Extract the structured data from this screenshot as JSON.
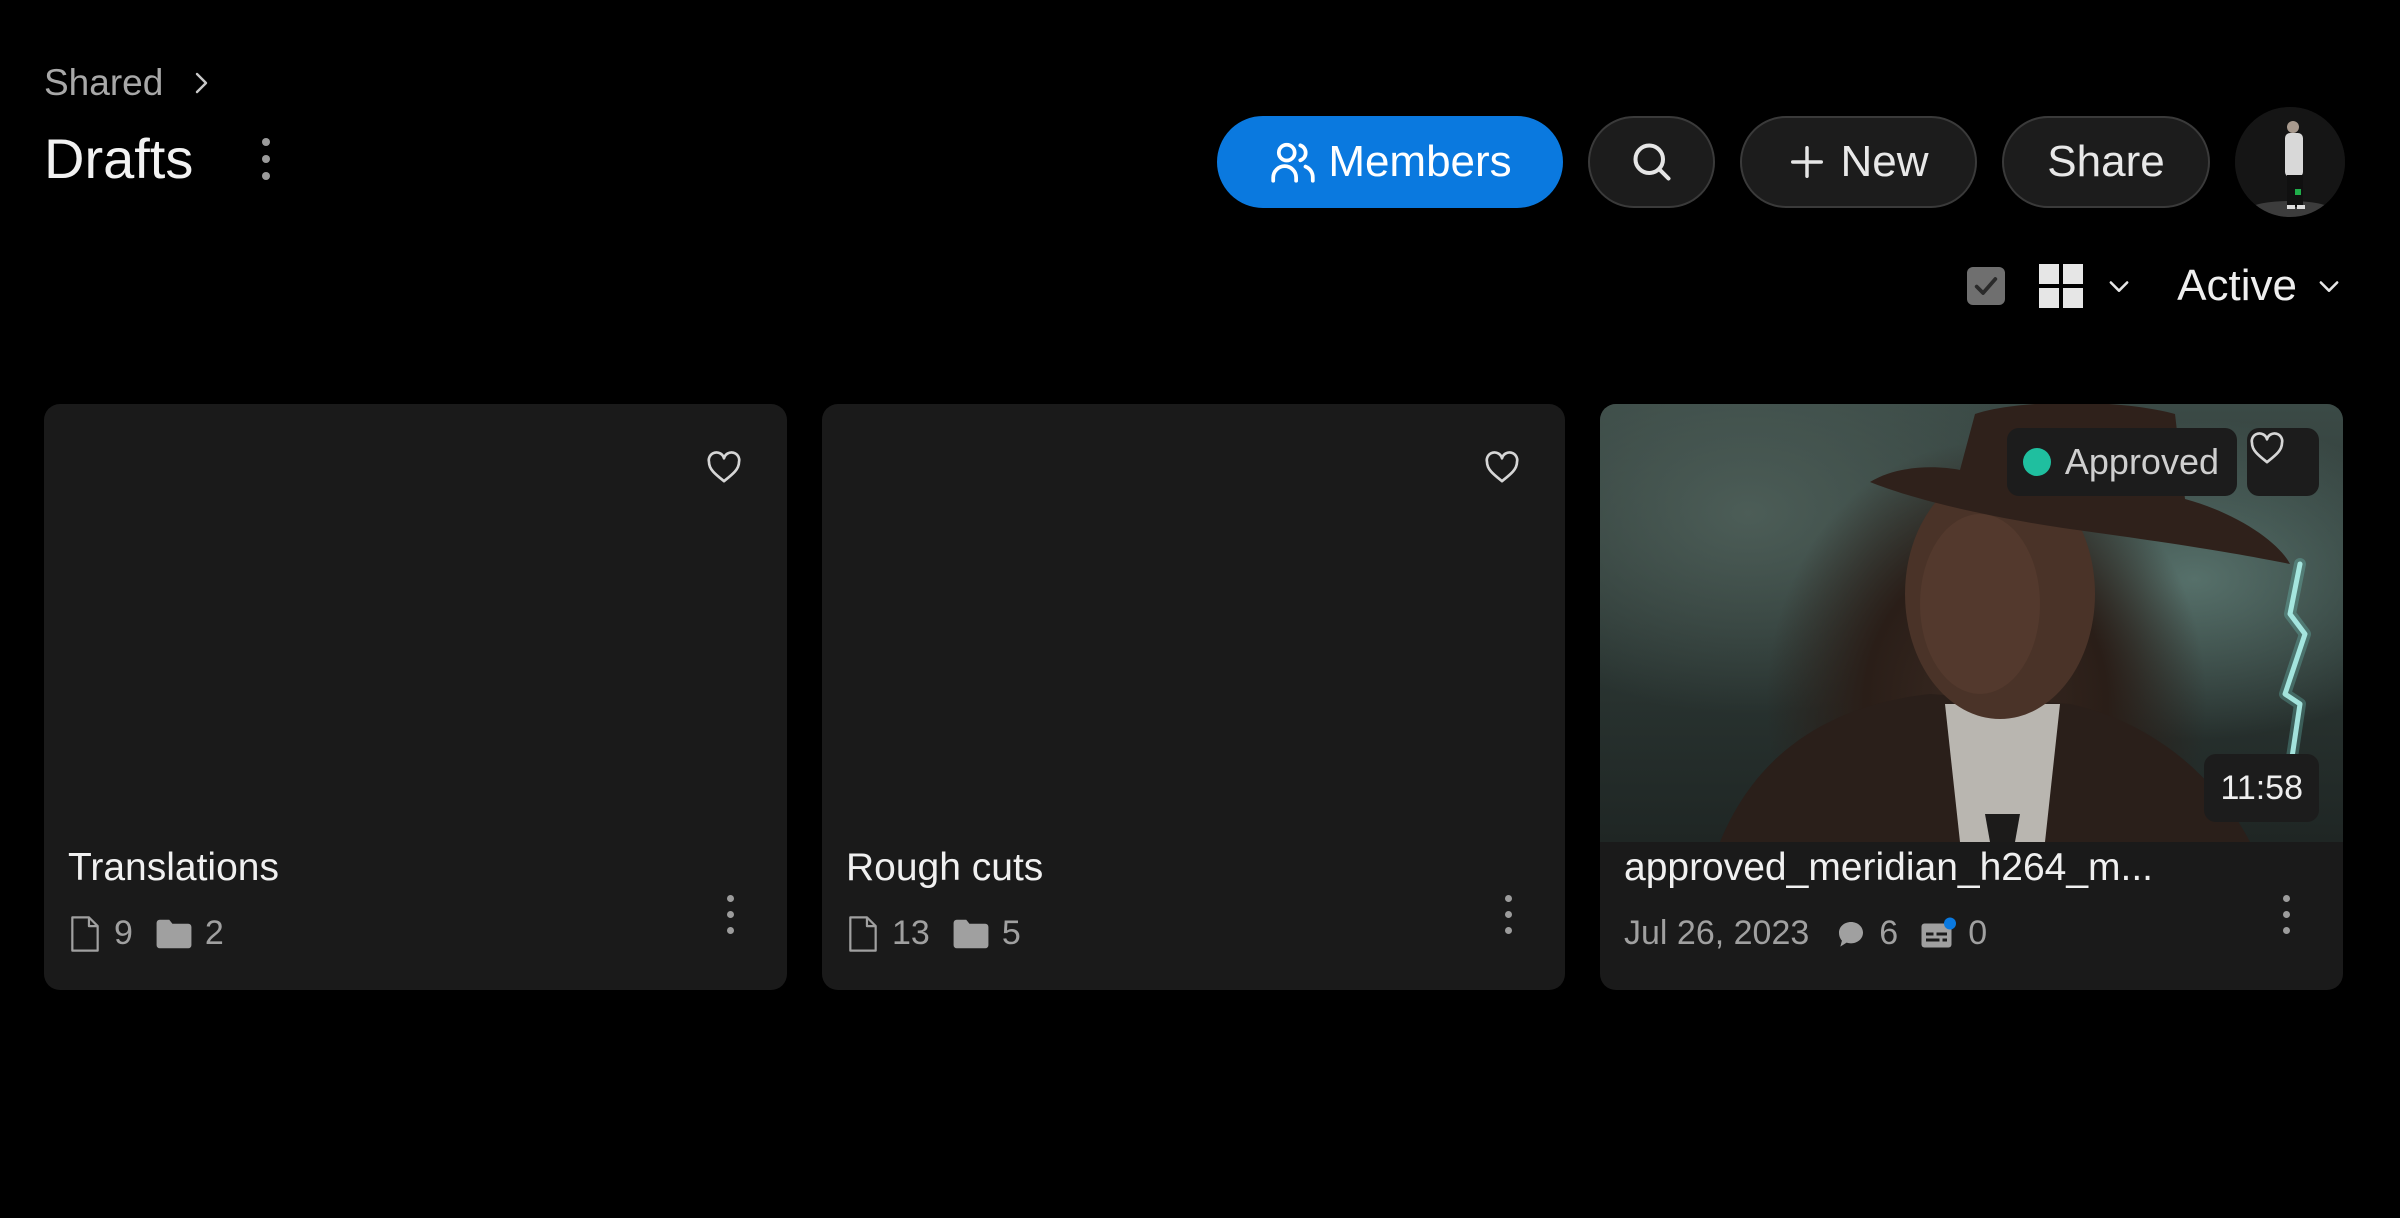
{
  "breadcrumb": {
    "parent": "Shared",
    "chevron_icon": "chevron-right-icon"
  },
  "page": {
    "title": "Drafts",
    "menu_icon": "more-vertical-icon"
  },
  "actions": {
    "members_label": "Members",
    "search_icon": "search-icon",
    "new_label": "New",
    "share_label": "Share",
    "avatar": "user-avatar"
  },
  "toolbar": {
    "select_all_checked": true,
    "view_mode": "grid",
    "status_filter": "Active"
  },
  "colors": {
    "accent": "#0a79df",
    "approved": "#1fbf9f",
    "card_bg": "#1a1a1a",
    "page_bg": "#000000",
    "notification_dot": "#0a79df"
  },
  "cards": [
    {
      "type": "folder",
      "name": "Translations",
      "files": "9",
      "folders": "2",
      "favorited": false
    },
    {
      "type": "folder",
      "name": "Rough cuts",
      "files": "13",
      "folders": "5",
      "favorited": false
    },
    {
      "type": "video",
      "name": "approved_meridian_h264_m...",
      "status": "Approved",
      "duration": "11:58",
      "date": "Jul 26, 2023",
      "comments": "6",
      "captions": "0",
      "favorited": false
    }
  ]
}
